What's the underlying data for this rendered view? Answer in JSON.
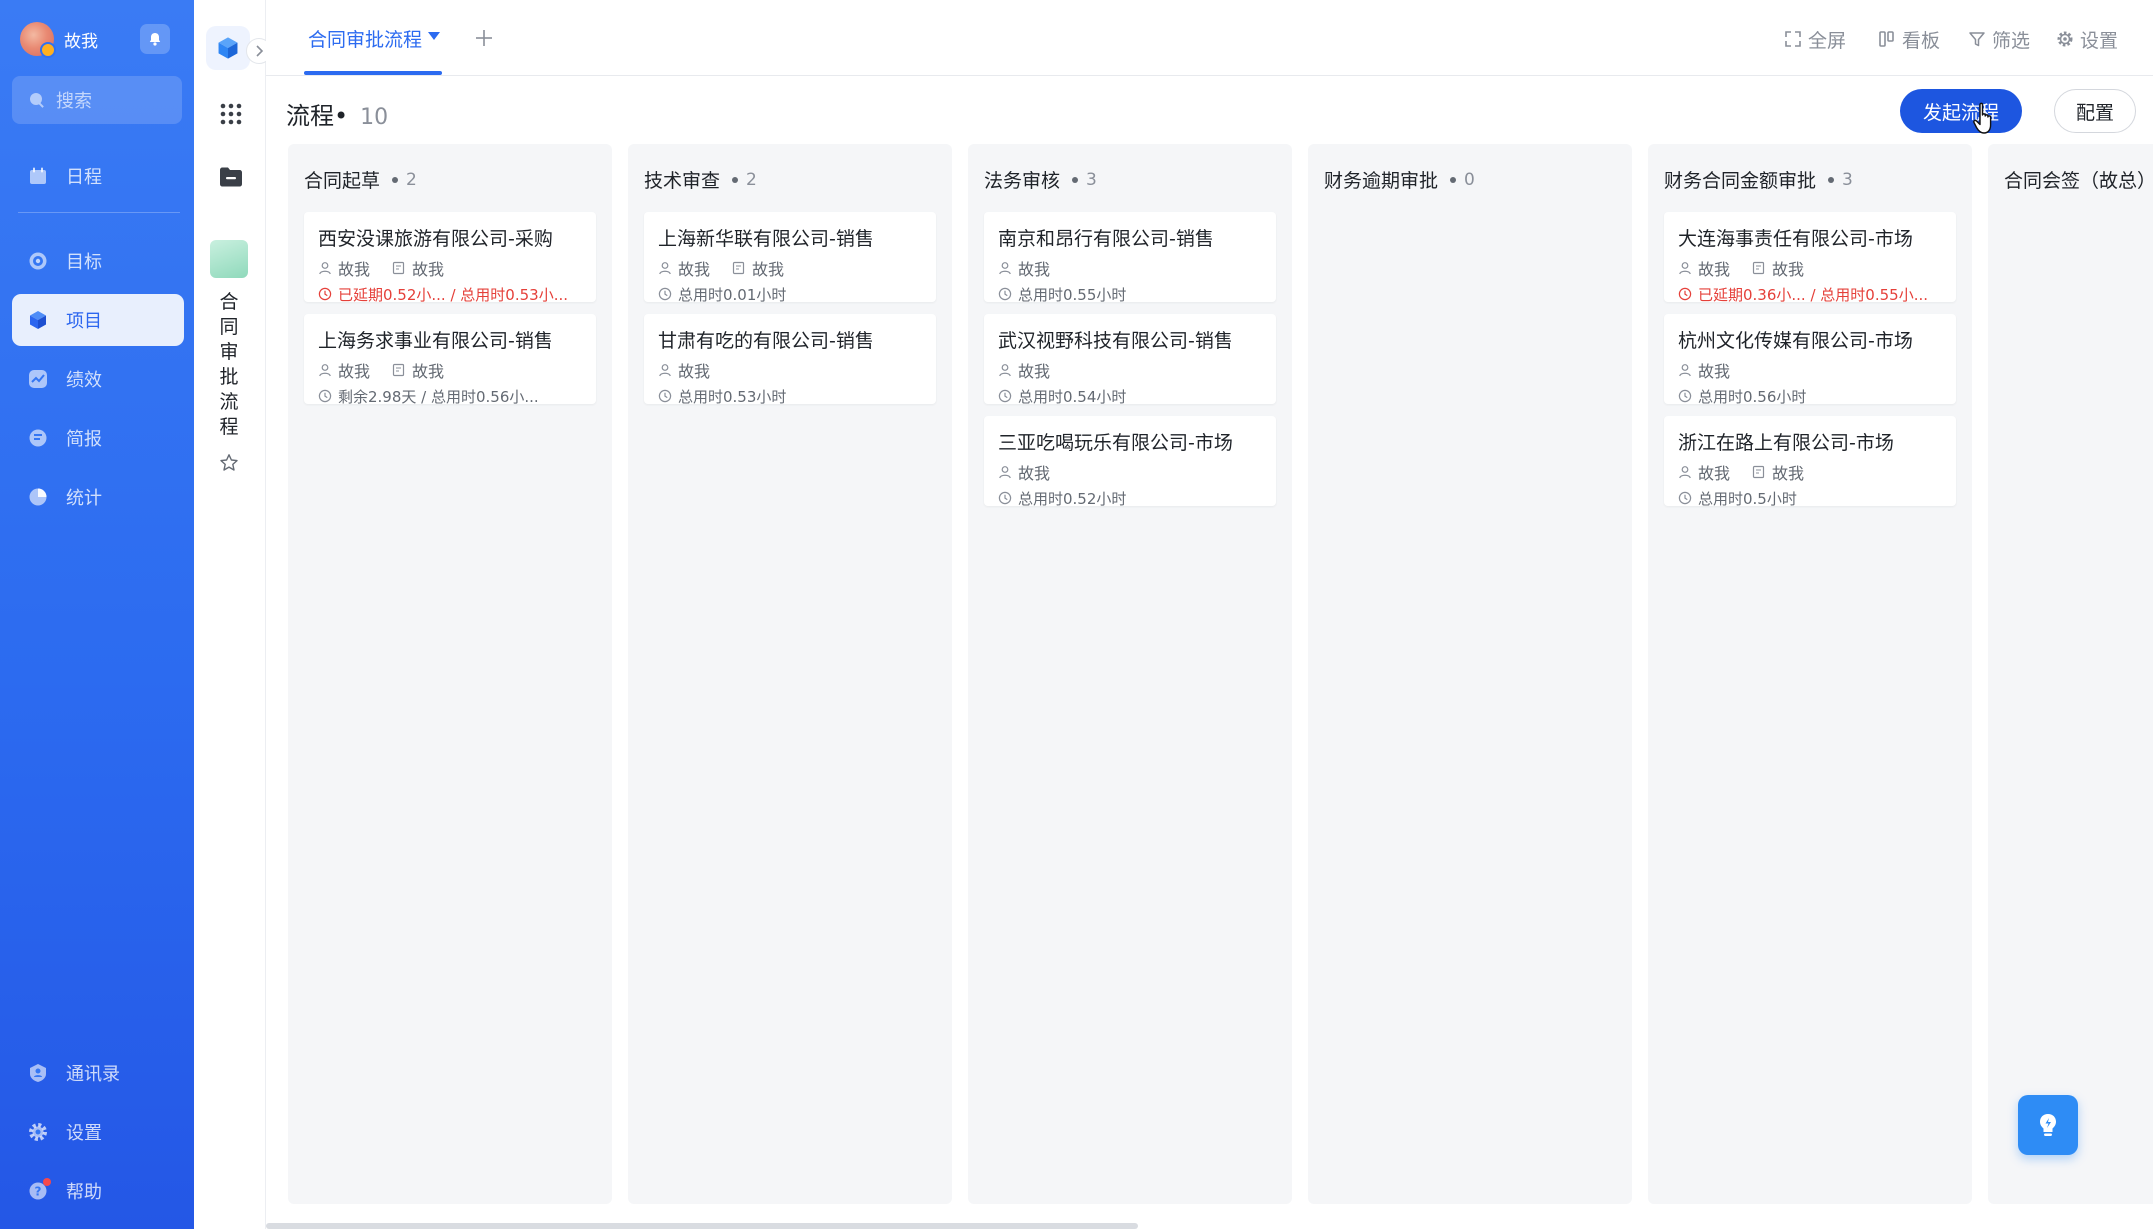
{
  "sidebar": {
    "username": "故我",
    "search_placeholder": "搜索",
    "items": [
      {
        "label": "日程"
      },
      {
        "label": "目标"
      },
      {
        "label": "项目"
      },
      {
        "label": "绩效"
      },
      {
        "label": "简报"
      },
      {
        "label": "统计"
      }
    ],
    "bottom": [
      {
        "label": "通讯录"
      },
      {
        "label": "设置"
      },
      {
        "label": "帮助"
      }
    ]
  },
  "rail": {
    "project_name": "合同审批流程"
  },
  "topbar": {
    "active_tab": "合同审批流程",
    "tools": {
      "fullscreen": "全屏",
      "board": "看板",
      "filter": "筛选",
      "settings": "设置"
    }
  },
  "page": {
    "title": "流程•",
    "count": "10",
    "start_button": "发起流程",
    "config_button": "配置"
  },
  "columns": [
    {
      "name": "合同起草",
      "count": "2",
      "cards": [
        {
          "title": "西安没课旅游有限公司-采购",
          "owner": "故我",
          "reviewer": "故我",
          "time": "已延期0.52小... / 总用时0.53小...",
          "late": true
        },
        {
          "title": "上海务求事业有限公司-销售",
          "owner": "故我",
          "reviewer": "故我",
          "time": "剩余2.98天 / 总用时0.56小...",
          "late": false
        }
      ]
    },
    {
      "name": "技术审查",
      "count": "2",
      "cards": [
        {
          "title": "上海新华联有限公司-销售",
          "owner": "故我",
          "reviewer": "故我",
          "time": "总用时0.01小时",
          "late": false
        },
        {
          "title": "甘肃有吃的有限公司-销售",
          "owner": "故我",
          "reviewer": "",
          "time": "总用时0.53小时",
          "late": false
        }
      ]
    },
    {
      "name": "法务审核",
      "count": "3",
      "cards": [
        {
          "title": "南京和昂行有限公司-销售",
          "owner": "故我",
          "reviewer": "",
          "time": "总用时0.55小时",
          "late": false
        },
        {
          "title": "武汉视野科技有限公司-销售",
          "owner": "故我",
          "reviewer": "",
          "time": "总用时0.54小时",
          "late": false
        },
        {
          "title": "三亚吃喝玩乐有限公司-市场",
          "owner": "故我",
          "reviewer": "",
          "time": "总用时0.52小时",
          "late": false
        }
      ]
    },
    {
      "name": "财务逾期审批",
      "count": "0",
      "cards": []
    },
    {
      "name": "财务合同金额审批",
      "count": "3",
      "cards": [
        {
          "title": "大连海事责任有限公司-市场",
          "owner": "故我",
          "reviewer": "故我",
          "time": "已延期0.36小... / 总用时0.55小...",
          "late": true
        },
        {
          "title": "杭州文化传媒有限公司-市场",
          "owner": "故我",
          "reviewer": "",
          "time": "总用时0.56小时",
          "late": false
        },
        {
          "title": "浙江在路上有限公司-市场",
          "owner": "故我",
          "reviewer": "故我",
          "time": "总用时0.5小时",
          "late": false
        }
      ]
    },
    {
      "name": "合同会签（故总）",
      "count": "",
      "cards": []
    }
  ],
  "colors": {
    "sidebar_blue": "#2c6bf0",
    "primary_button": "#1d56e0",
    "late_red": "#e5403a",
    "column_bg": "#f5f6f8"
  }
}
